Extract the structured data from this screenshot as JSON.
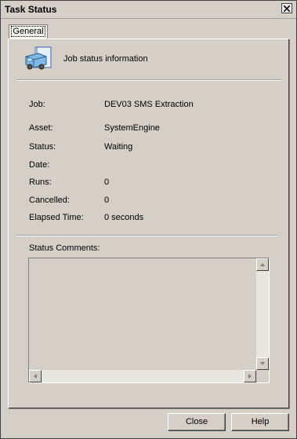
{
  "window": {
    "title": "Task Status"
  },
  "tabs": [
    {
      "label": "General"
    }
  ],
  "header": {
    "text": "Job status information"
  },
  "fields": [
    {
      "label": "Job:",
      "value": "DEV03 SMS Extraction"
    },
    {
      "label": "Asset:",
      "value": "SystemEngine"
    },
    {
      "label": "Status:",
      "value": "Waiting"
    },
    {
      "label": "Date:",
      "value": ""
    },
    {
      "label": "Runs:",
      "value": "0"
    },
    {
      "label": "Cancelled:",
      "value": "0"
    },
    {
      "label": "Elapsed Time:",
      "value": "0 seconds"
    }
  ],
  "comments": {
    "label": "Status Comments:",
    "value": ""
  },
  "buttons": {
    "close": "Close",
    "help": "Help"
  },
  "icons": {
    "title_close": "close-icon",
    "header": "truck-document-icon"
  }
}
